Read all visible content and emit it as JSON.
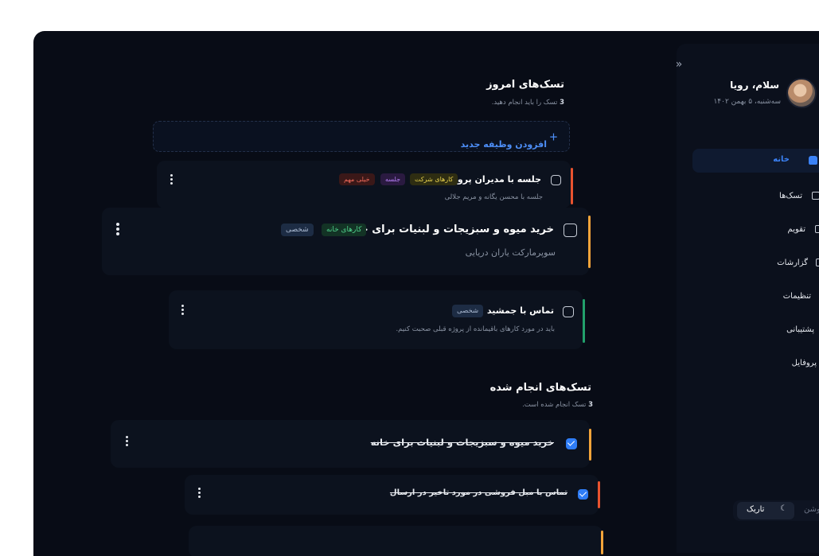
{
  "sidebar": {
    "user_name": "سلام، رویا",
    "date": "سه‌شنبه، ۵ بهمن ۱۴۰۲",
    "nav": {
      "home": "خانه",
      "tasks": "تسک‌ها",
      "calendar": "تقویم",
      "reports": "گزارشات",
      "settings": "تنظیمات",
      "support": "پشتیبانی",
      "profile": "پروفایل"
    },
    "theme_dark": "تاریک",
    "theme_light": "روشن"
  },
  "today": {
    "title": "تسک‌های امروز",
    "count": "3",
    "subtitle_rest": "تسک را باید انجام دهید.",
    "add_label": "افزودن وظیفه جدید",
    "tasks": [
      {
        "title": "جلسه با مدیران پروژه",
        "desc": "جلسه با محسن یگانه و مریم جلالی",
        "tags": [
          "کارهای شرکت",
          "جلسه",
          "خیلی مهم"
        ]
      },
      {
        "title": "خرید میوه و سبزیجات و لبنیات برای خانه",
        "desc": "سوپرمارکت یاران دریایی",
        "tags": [
          "کارهای خانه",
          "شخصی"
        ]
      },
      {
        "title": "تماس با جمشید",
        "desc": "باید در مورد کارهای باقیمانده از پروژه قبلی صحبت کنیم.",
        "tags": [
          "شخصی"
        ]
      }
    ]
  },
  "done": {
    "title": "تسک‌های انجام شده",
    "count": "3",
    "subtitle_rest": "تسک انجام شده است.",
    "tasks": [
      {
        "title": "خرید میوه و سبزیجات و لبنیات برای خانه"
      },
      {
        "title": "تماس با مبل فروشی در مورد تاخیر در ارسال"
      }
    ]
  },
  "colors": {
    "accent": "#3b82f6",
    "strip_red": "#e8532f",
    "strip_orange": "#f2a43a",
    "strip_green": "#22a06b"
  }
}
